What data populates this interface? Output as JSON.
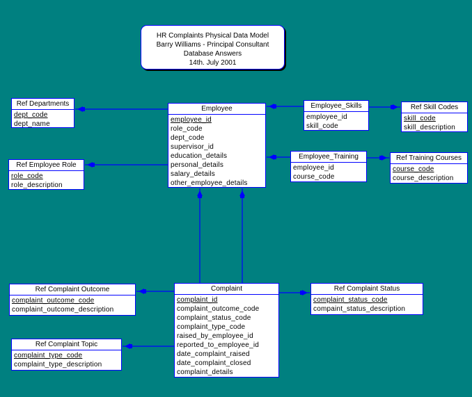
{
  "title_block": {
    "lines": [
      "HR Complaints Physical Data Model",
      "Barry Williams - Principal Consultant",
      "Database Answers",
      "14th. July 2001"
    ]
  },
  "colors": {
    "background": "#008080",
    "entity_fill": "#ffffff",
    "entity_border": "#0000ff",
    "connector": "#0000ff",
    "shadow": "#000000"
  },
  "entities": {
    "ref_departments": {
      "name": "Ref Departments",
      "attributes": [
        {
          "name": "dept_code",
          "pk": true
        },
        {
          "name": "dept_name",
          "pk": false
        }
      ]
    },
    "ref_employee_role": {
      "name": "Ref Employee Role",
      "attributes": [
        {
          "name": "role_code",
          "pk": true
        },
        {
          "name": "role_description",
          "pk": false
        }
      ]
    },
    "employee": {
      "name": "Employee",
      "attributes": [
        {
          "name": "employee_id",
          "pk": true
        },
        {
          "name": "role_code",
          "pk": false
        },
        {
          "name": "dept_code",
          "pk": false
        },
        {
          "name": "supervisor_id",
          "pk": false
        },
        {
          "name": "education_details",
          "pk": false
        },
        {
          "name": "personal_details",
          "pk": false
        },
        {
          "name": "salary_details",
          "pk": false
        },
        {
          "name": "other_employee_details",
          "pk": false
        }
      ]
    },
    "employee_skills": {
      "name": "Employee_Skills",
      "attributes": [
        {
          "name": "employee_id",
          "pk": false
        },
        {
          "name": "skill_code",
          "pk": false
        }
      ]
    },
    "ref_skill_codes": {
      "name": "Ref Skill Codes",
      "attributes": [
        {
          "name": "skill_code",
          "pk": true
        },
        {
          "name": "skill_description",
          "pk": false
        }
      ]
    },
    "employee_training": {
      "name": "Employee_Training",
      "attributes": [
        {
          "name": "employee_id",
          "pk": false
        },
        {
          "name": "course_code",
          "pk": false
        }
      ]
    },
    "ref_training_courses": {
      "name": "Ref Training Courses",
      "attributes": [
        {
          "name": "course_code",
          "pk": true
        },
        {
          "name": "course_description",
          "pk": false
        }
      ]
    },
    "ref_complaint_outcome": {
      "name": "Ref Complaint Outcome",
      "attributes": [
        {
          "name": "complaint_outcome_code",
          "pk": true
        },
        {
          "name": "complaint_outcome_description",
          "pk": false
        }
      ]
    },
    "ref_complaint_topic": {
      "name": "Ref Complaint Topic",
      "attributes": [
        {
          "name": "complaint_type_code",
          "pk": true
        },
        {
          "name": "complaint_type_description",
          "pk": false
        }
      ]
    },
    "complaint": {
      "name": "Complaint",
      "attributes": [
        {
          "name": "complaint_id",
          "pk": true
        },
        {
          "name": "complaint_outcome_code",
          "pk": false
        },
        {
          "name": "complaint_status_code",
          "pk": false
        },
        {
          "name": "complaint_type_code",
          "pk": false
        },
        {
          "name": "raised_by_employee_id",
          "pk": false
        },
        {
          "name": "reported_to_employee_id",
          "pk": false
        },
        {
          "name": "date_complaint_raised",
          "pk": false
        },
        {
          "name": "date_complaint_closed",
          "pk": false
        },
        {
          "name": "complaint_details",
          "pk": false
        }
      ]
    },
    "ref_complaint_status": {
      "name": "Ref Complaint Status",
      "attributes": [
        {
          "name": "complaint_status_code",
          "pk": true
        },
        {
          "name": "compaint_status_description",
          "pk": false
        }
      ]
    }
  },
  "relationships": [
    {
      "from": "employee",
      "to": "ref_departments"
    },
    {
      "from": "employee",
      "to": "ref_employee_role"
    },
    {
      "from": "employee_skills",
      "to": "employee"
    },
    {
      "from": "employee_skills",
      "to": "ref_skill_codes"
    },
    {
      "from": "employee_training",
      "to": "employee"
    },
    {
      "from": "employee_training",
      "to": "ref_training_courses"
    },
    {
      "from": "complaint",
      "to": "employee",
      "role": "raised_by"
    },
    {
      "from": "complaint",
      "to": "employee",
      "role": "reported_to"
    },
    {
      "from": "complaint",
      "to": "ref_complaint_outcome"
    },
    {
      "from": "complaint",
      "to": "ref_complaint_topic"
    },
    {
      "from": "complaint",
      "to": "ref_complaint_status"
    }
  ]
}
